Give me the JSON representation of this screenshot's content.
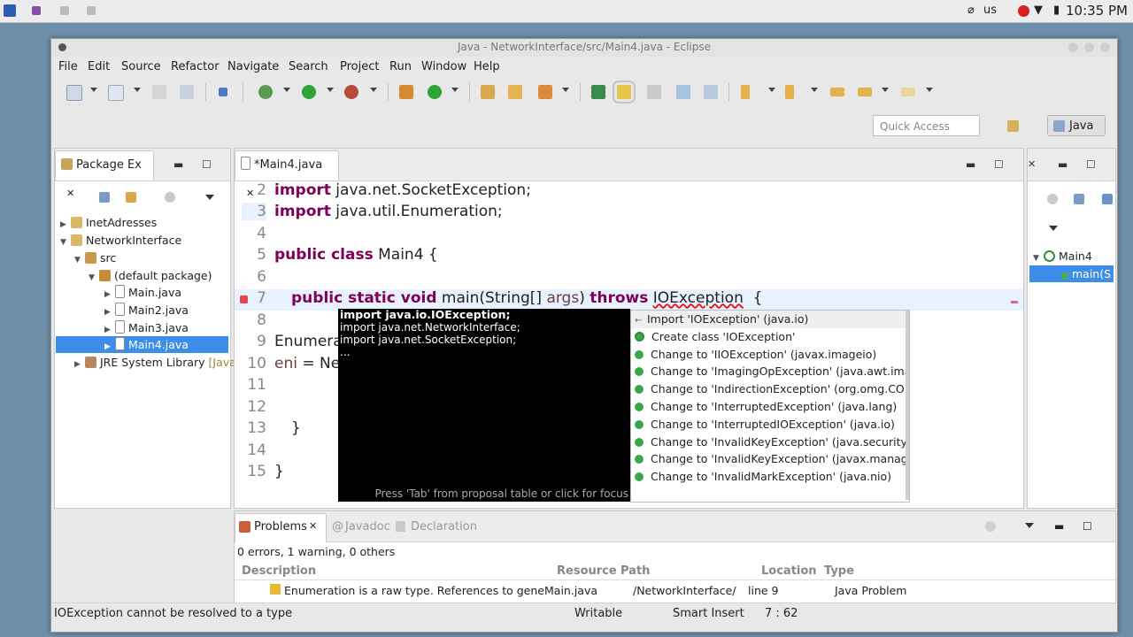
{
  "system": {
    "clock": "10:35 PM",
    "keyboard_layout": "us"
  },
  "window": {
    "title": "Java - NetworkInterface/src/Main4.java - Eclipse"
  },
  "menu": [
    "File",
    "Edit",
    "Source",
    "Refactor",
    "Navigate",
    "Search",
    "Project",
    "Run",
    "Window",
    "Help"
  ],
  "quick_access": {
    "placeholder": "Quick Access"
  },
  "perspective": {
    "label": "Java"
  },
  "package_explorer": {
    "tab_label": "Package Ex",
    "items": [
      {
        "label": "InetAdresses",
        "level": 0,
        "icon": "project-icon"
      },
      {
        "label": "NetworkInterface",
        "level": 0,
        "icon": "project-icon"
      },
      {
        "label": "src",
        "level": 1,
        "icon": "source-folder-icon"
      },
      {
        "label": "(default package)",
        "level": 2,
        "icon": "package-icon"
      },
      {
        "label": "Main.java",
        "level": 3,
        "icon": "java-file-icon"
      },
      {
        "label": "Main2.java",
        "level": 3,
        "icon": "java-file-icon"
      },
      {
        "label": "Main3.java",
        "level": 3,
        "icon": "java-file-icon"
      },
      {
        "label": "Main4.java",
        "level": 3,
        "icon": "java-file-icon",
        "selected": true
      },
      {
        "label": "JRE System Library",
        "level": 1,
        "icon": "library-icon",
        "suffix": "[Java"
      }
    ]
  },
  "editor": {
    "tab_label": "*Main4.java",
    "line_numbers": [
      "2",
      "3",
      "4",
      "5",
      "6",
      "7",
      "8",
      "9",
      "10",
      "11",
      "12",
      "13",
      "14",
      "15"
    ],
    "lines": {
      "l2_kw": "import",
      "l2_rest": " java.net.SocketException;",
      "l3_kw": "import",
      "l3_rest": " java.util.Enumeration;",
      "l5_kw": "public class",
      "l5_rest": " Main4 {",
      "l7_kw1": "public static void",
      "l7_mid": " main(String[] ",
      "l7_param": "args",
      "l7_close": ") ",
      "l7_kw2": "throws",
      "l7_err": "IOException",
      "l7_end": "  {",
      "l9": "Enumera",
      "l10_var": "eni",
      "l10_rest": " = Ne",
      "l13": "}",
      "l15": "}"
    }
  },
  "quickfix": {
    "imports": [
      "import java.io.IOException;",
      "import java.net.NetworkInterface;",
      "import java.net.SocketException;",
      "..."
    ],
    "hint": "Press 'Tab' from proposal table or click for focus",
    "proposals": [
      "Import 'IOException' (java.io)",
      "Create class 'IOException'",
      "Change to 'IIOException' (javax.imageio)",
      "Change to 'ImagingOpException' (java.awt.image",
      "Change to 'IndirectionException' (org.omg.CORB/",
      "Change to 'InterruptedException' (java.lang)",
      "Change to 'InterruptedIOException' (java.io)",
      "Change to 'InvalidKeyException' (java.security)",
      "Change to 'InvalidKeyException' (javax.managem",
      "Change to 'InvalidMarkException' (java.nio)"
    ]
  },
  "outline": {
    "class_name": "Main4",
    "method": "main(S"
  },
  "problems": {
    "tabs": [
      "Problems",
      "Javadoc",
      "Declaration"
    ],
    "summary": "0 errors, 1 warning, 0 others",
    "columns": [
      "Description",
      "Resource",
      "Path",
      "Location",
      "Type"
    ],
    "rows": [
      {
        "description": "Enumeration is a raw type. References to gene",
        "resource": "Main.java",
        "path": "/NetworkInterface/",
        "location": "line 9",
        "type": "Java Problem"
      }
    ]
  },
  "status": {
    "message": "IOException cannot be resolved to a type",
    "mode": "Writable",
    "insert": "Smart Insert",
    "position": "7 : 62"
  },
  "colors": {
    "keyword": "#7f0055",
    "selection": "#3d8ee8",
    "error": "#e00000"
  }
}
